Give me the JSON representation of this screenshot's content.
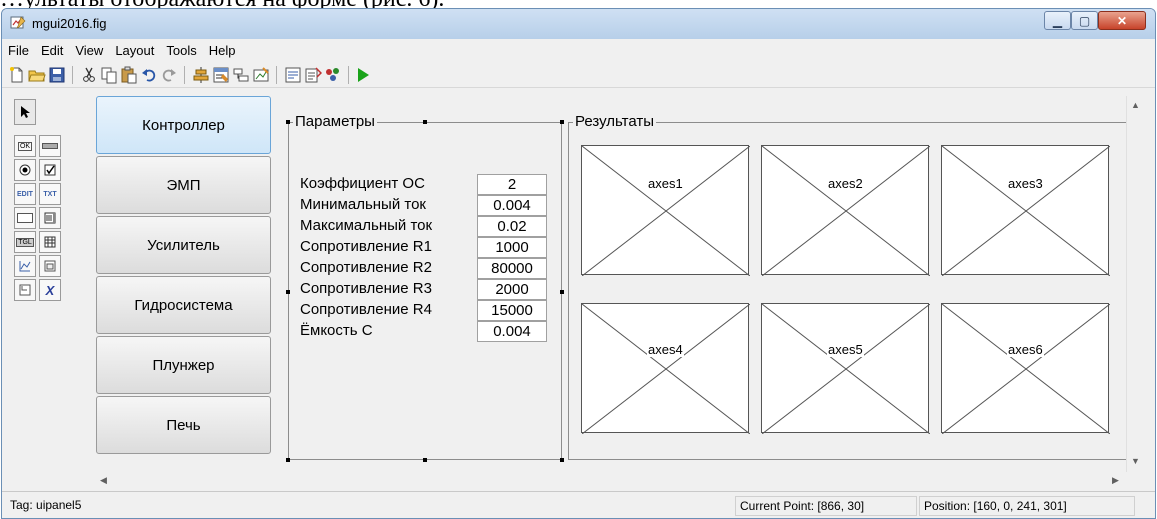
{
  "background_doc_text": "…ультаты отображаются на форме (рис. 6).",
  "window": {
    "title": "mgui2016.fig"
  },
  "menu": [
    "File",
    "Edit",
    "View",
    "Layout",
    "Tools",
    "Help"
  ],
  "tabs": [
    "Контроллер",
    "ЭМП",
    "Усилитель",
    "Гидросистема",
    "Плунжер",
    "Печь"
  ],
  "parameters_panel": {
    "title": "Параметры",
    "rows": [
      {
        "label": "Коэффициент ОС",
        "value": "2"
      },
      {
        "label": "Минимальный ток",
        "value": "0.004"
      },
      {
        "label": "Максимальный ток",
        "value": "0.02"
      },
      {
        "label": "Сопротивление R1",
        "value": "1000"
      },
      {
        "label": "Сопротивление R2",
        "value": "80000"
      },
      {
        "label": "Сопротивление R3",
        "value": "2000"
      },
      {
        "label": "Сопротивление R4",
        "value": "15000"
      },
      {
        "label": "Ёмкость С",
        "value": "0.004"
      }
    ]
  },
  "results_panel": {
    "title": "Результаты",
    "axes": [
      "axes1",
      "axes2",
      "axes3",
      "axes4",
      "axes5",
      "axes6"
    ]
  },
  "status": {
    "tag": "Tag: uipanel5",
    "current_point": "Current Point:  [866, 30]",
    "position": "Position: [160, 0, 241, 301]"
  },
  "toolbar_icons": [
    "new-icon",
    "open-icon",
    "save-icon",
    "cut-icon",
    "copy-icon",
    "paste-icon",
    "undo-icon",
    "redo-icon",
    "align-icon",
    "menu-editor-icon",
    "tab-order-icon",
    "toolbar-editor-icon",
    "mfile-editor-icon",
    "property-inspector-icon",
    "object-browser-icon",
    "run-icon"
  ],
  "palette_icons": [
    "select-arrow-icon",
    "push-button-icon",
    "slider-icon",
    "radio-button-icon",
    "checkbox-icon",
    "edit-text-icon",
    "static-text-icon",
    "popup-menu-icon",
    "listbox-icon",
    "toggle-button-icon",
    "table-icon",
    "axes-icon",
    "panel-icon",
    "button-group-icon",
    "activex-icon"
  ],
  "colors": {
    "accent": "#6aa5d8",
    "run": "#1aa31a",
    "close": "#c7432a"
  }
}
